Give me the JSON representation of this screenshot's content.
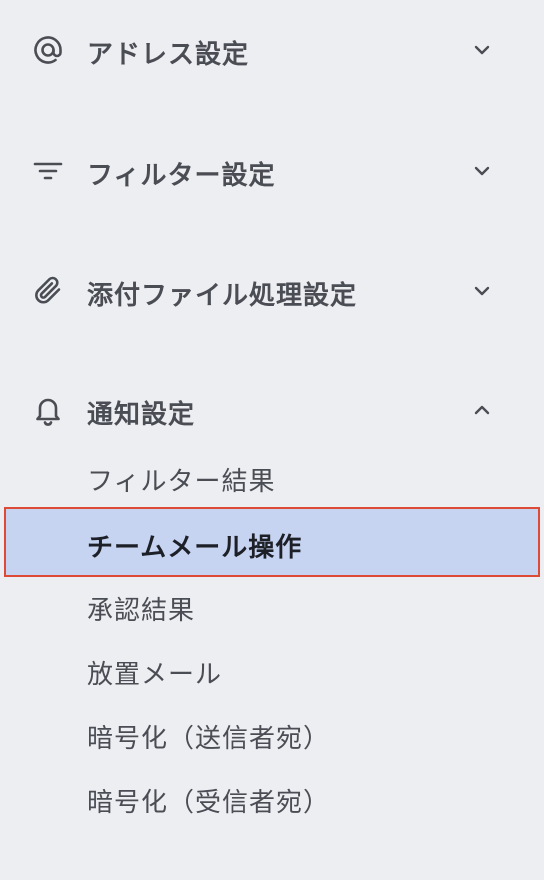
{
  "colors": {
    "background": "#edeef2",
    "text": "#4b4d55",
    "active_background": "#c6d4f1",
    "active_border": "#dd4a36",
    "active_text": "#1e2028"
  },
  "sections": [
    {
      "label": "アドレス設定",
      "icon": "at-sign-icon",
      "expanded": false
    },
    {
      "label": "フィルター設定",
      "icon": "filter-icon",
      "expanded": false
    },
    {
      "label": "添付ファイル処理設定",
      "icon": "paperclip-icon",
      "expanded": false
    },
    {
      "label": "通知設定",
      "icon": "bell-icon",
      "expanded": true
    }
  ],
  "notification_items": [
    {
      "label": "フィルター結果",
      "selected": false
    },
    {
      "label": "チームメール操作",
      "selected": true
    },
    {
      "label": "承認結果",
      "selected": false
    },
    {
      "label": "放置メール",
      "selected": false
    },
    {
      "label": "暗号化（送信者宛）",
      "selected": false
    },
    {
      "label": "暗号化（受信者宛）",
      "selected": false
    }
  ]
}
